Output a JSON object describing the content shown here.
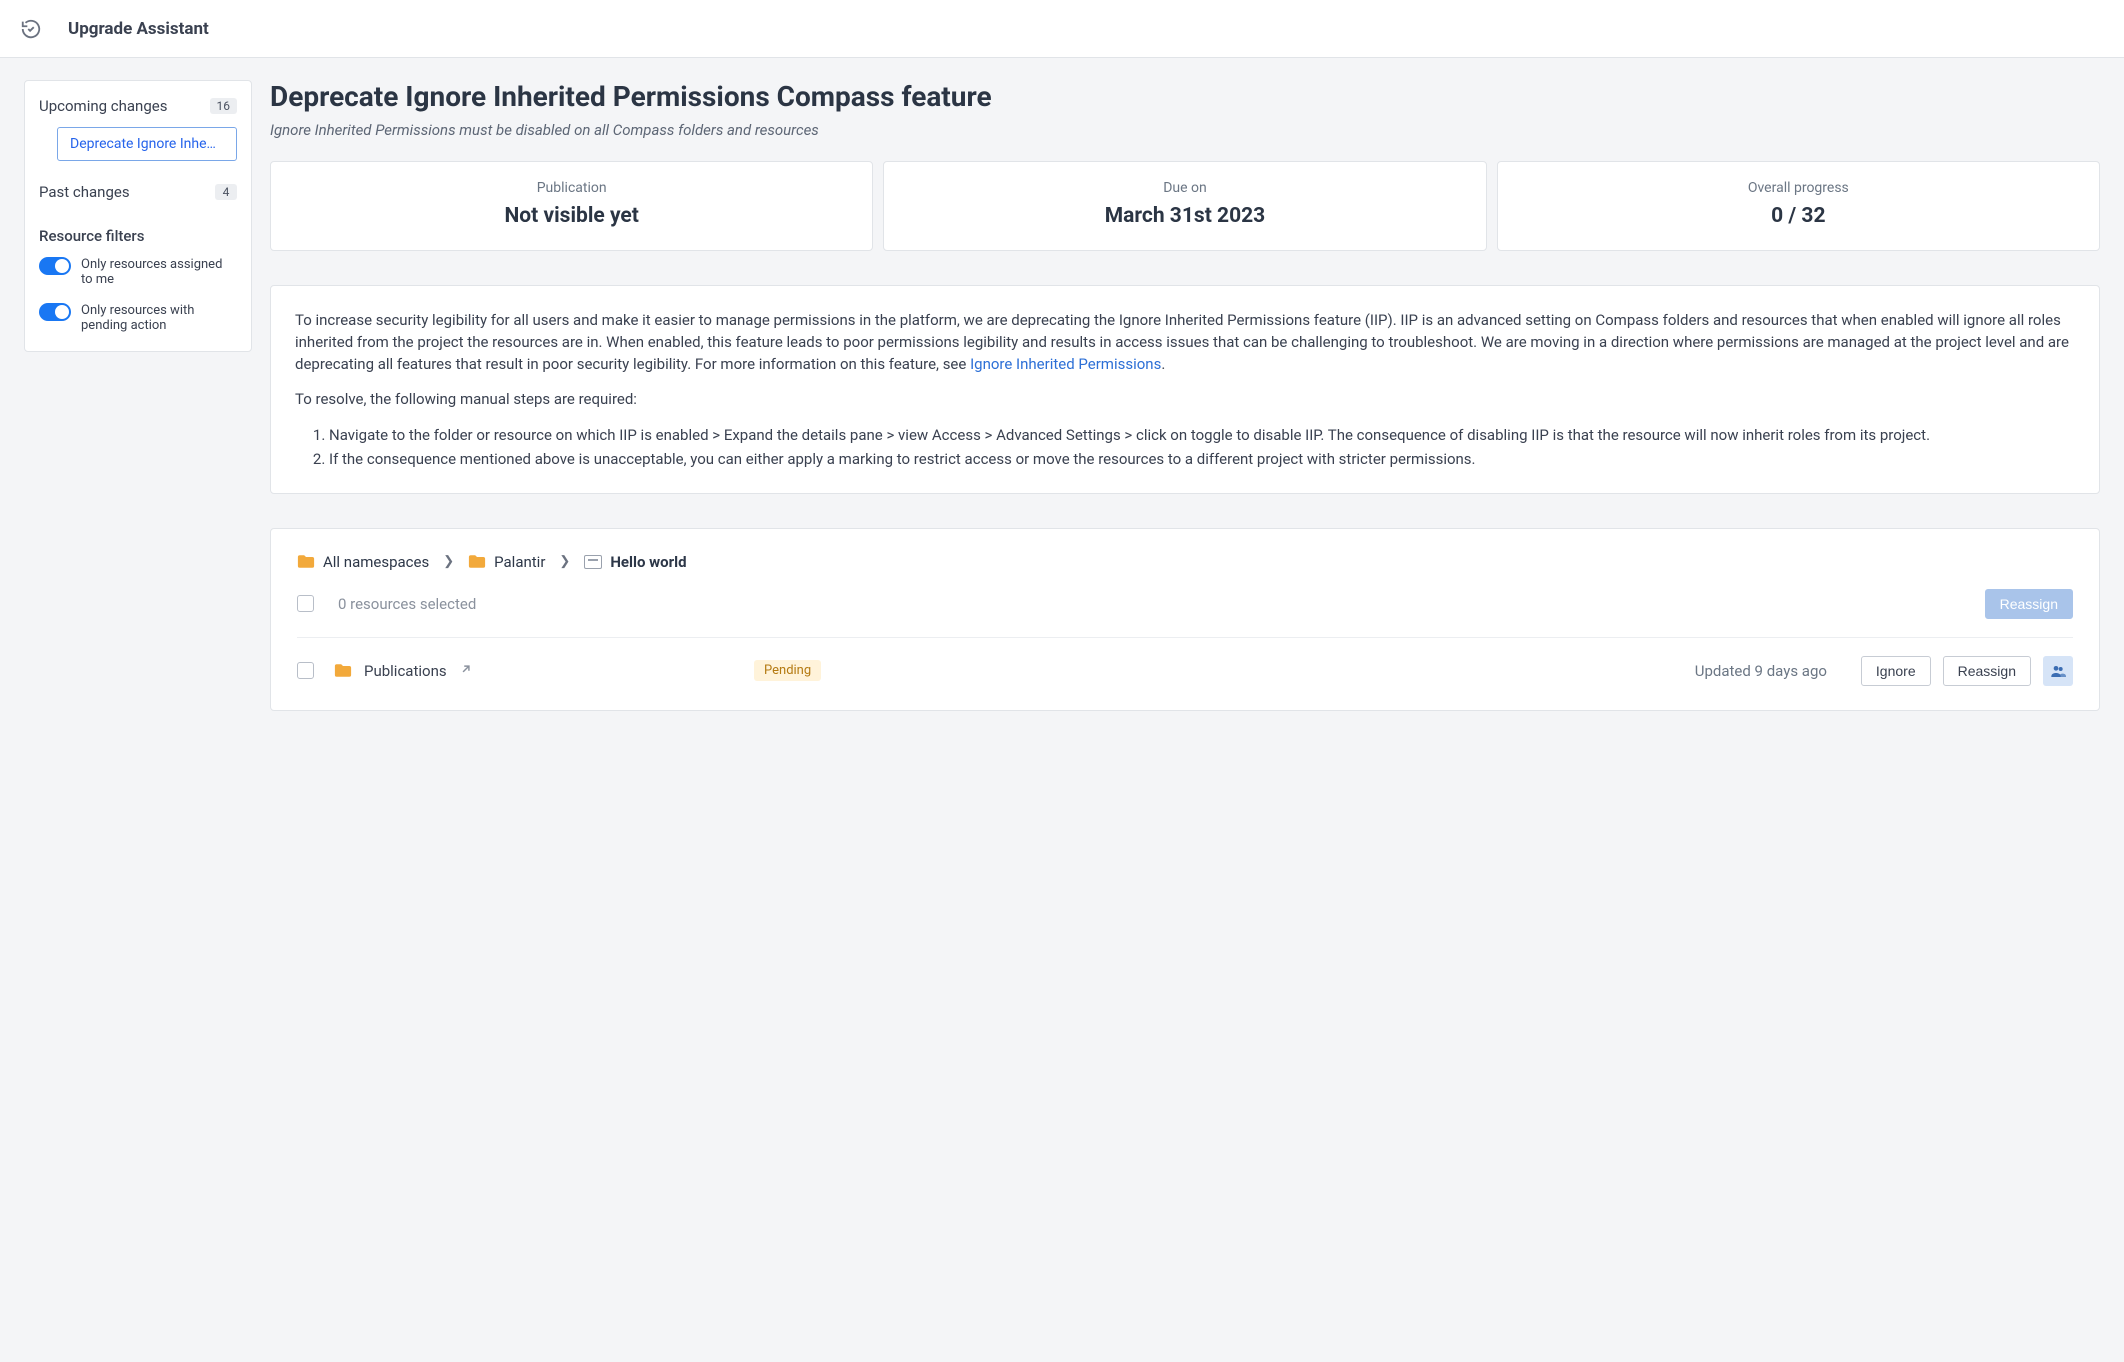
{
  "app_title": "Upgrade Assistant",
  "sidebar": {
    "upcoming_label": "Upcoming changes",
    "upcoming_count": "16",
    "upcoming_item": "Deprecate Ignore Inhe…",
    "past_label": "Past changes",
    "past_count": "4",
    "filters_heading": "Resource filters",
    "filter_mine": "Only resources assigned to me",
    "filter_pending": "Only resources with pending action"
  },
  "page": {
    "title": "Deprecate Ignore Inherited Permissions Compass feature",
    "subtitle": "Ignore Inherited Permissions must be disabled on all Compass folders and resources"
  },
  "cards": {
    "publication_label": "Publication",
    "publication_value": "Not visible yet",
    "due_label": "Due on",
    "due_value": "March 31st 2023",
    "progress_label": "Overall progress",
    "progress_value": "0 / 32"
  },
  "desc": {
    "para1a": "To increase security legibility for all users and make it easier to manage permissions in the platform, we are deprecating the Ignore Inherited Permissions feature (IIP). IIP is an advanced setting on Compass folders and resources that when enabled will ignore all roles inherited from the project the resources are in. When enabled, this feature leads to poor permissions legibility and results in access issues that can be challenging to troubleshoot. We are moving in a direction where permissions are managed at the project level and are deprecating all features that result in poor security legibility. For more information on this feature, see ",
    "para1_link": "Ignore Inherited Permissions",
    "para1b": ".",
    "para2": "To resolve, the following manual steps are required:",
    "step1": "Navigate to the folder or resource on which IIP is enabled > Expand the details pane > view Access > Advanced Settings > click on toggle to disable IIP. The consequence of disabling IIP is that the resource will now inherit roles from its project.",
    "step2": "If the consequence mentioned above is unacceptable, you can either apply a marking to restrict access or move the resources to a different project with stricter permissions."
  },
  "breadcrumb": {
    "c1": "All namespaces",
    "c2": "Palantir",
    "c3": "Hello world"
  },
  "reslist": {
    "selected_text": "0 resources selected",
    "reassign_top": "Reassign",
    "row": {
      "name": "Publications",
      "status": "Pending",
      "updated": "Updated 9 days ago",
      "ignore": "Ignore",
      "reassign": "Reassign"
    }
  }
}
